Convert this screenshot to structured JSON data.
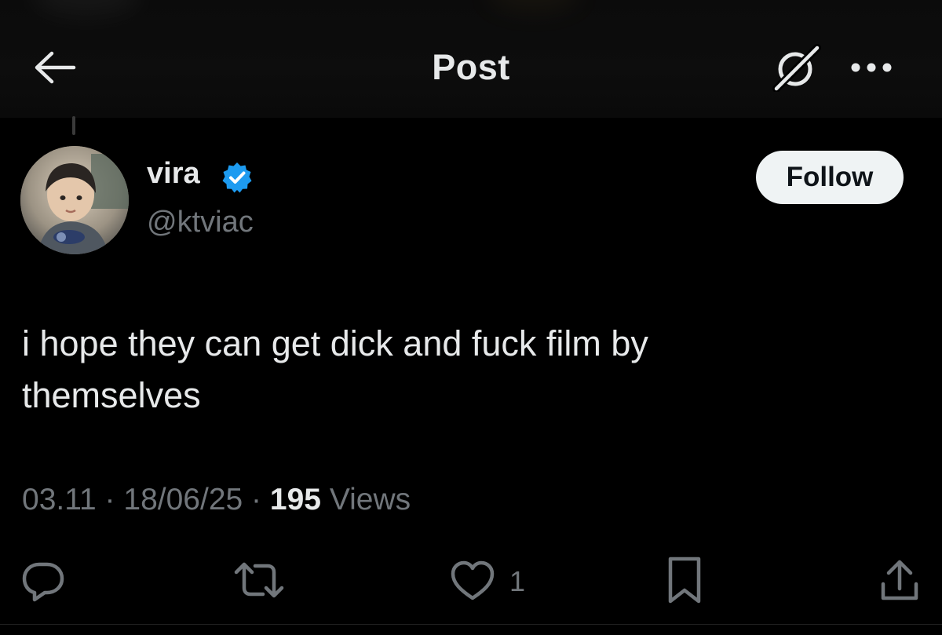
{
  "header": {
    "title": "Post",
    "back_icon": "arrow-left-icon",
    "grok_icon": "grok-icon",
    "more_icon": "more-horizontal-icon"
  },
  "author": {
    "display_name": "vira",
    "handle": "@ktviac",
    "verified": true,
    "verified_color": "#1d9bf0"
  },
  "follow_button": {
    "label": "Follow"
  },
  "post": {
    "text": "i hope they can get dick and fuck film by\nthemselves",
    "time": "03.11",
    "date": "18/06/25",
    "views_count": "195",
    "views_label": "Views",
    "separator": "·"
  },
  "actions": {
    "reply_icon": "reply-icon",
    "repost_icon": "repost-icon",
    "like_icon": "heart-icon",
    "like_count": "1",
    "bookmark_icon": "bookmark-icon",
    "share_icon": "share-icon"
  },
  "colors": {
    "background": "#000000",
    "text_primary": "#e7e9ea",
    "text_secondary": "#71767b",
    "accent": "#1d9bf0",
    "follow_bg": "#eff3f4"
  }
}
